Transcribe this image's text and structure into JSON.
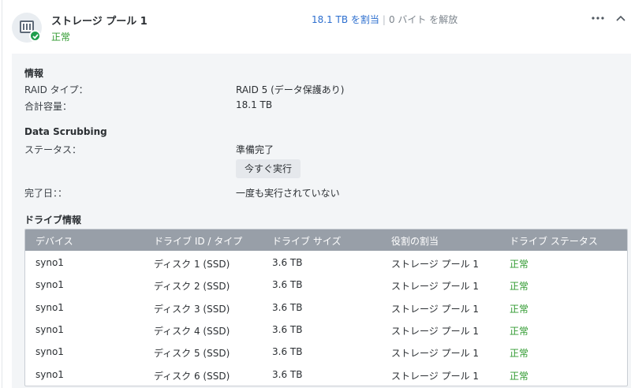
{
  "pool": {
    "title": "ストレージ プール 1",
    "status": "正常",
    "allocated": "18.1 TB を割当",
    "separator": "|",
    "freed": "0 バイト を解放",
    "more_icon": "ellipsis-icon",
    "collapse_icon": "chevron-up-icon",
    "status_color": "#2f9a2f",
    "link_color": "#2d6fcf"
  },
  "info": {
    "title": "情報",
    "raid_type_label": "RAID タイプ：",
    "raid_type_value": "RAID 5 (データ保護あり)",
    "capacity_label": "合計容量：",
    "capacity_value": "18.1 TB"
  },
  "scrubbing": {
    "title": "Data Scrubbing",
    "status_label": "ステータス：",
    "status_value": "準備完了",
    "run_now_label": "今すぐ実行",
    "completed_label": "完了日：：",
    "completed_value": "一度も実行されていない"
  },
  "drives": {
    "title": "ドライブ情報",
    "columns": [
      "デバイス",
      "ドライブ ID / タイプ",
      "ドライブ サイズ",
      "役割の割当",
      "ドライブ ステータス"
    ],
    "rows": [
      [
        "syno1",
        "ディスク 1 (SSD)",
        "3.6 TB",
        "ストレージ プール 1",
        "正常"
      ],
      [
        "syno1",
        "ディスク 2 (SSD)",
        "3.6 TB",
        "ストレージ プール 1",
        "正常"
      ],
      [
        "syno1",
        "ディスク 3 (SSD)",
        "3.6 TB",
        "ストレージ プール 1",
        "正常"
      ],
      [
        "syno1",
        "ディスク 4 (SSD)",
        "3.6 TB",
        "ストレージ プール 1",
        "正常"
      ],
      [
        "syno1",
        "ディスク 5 (SSD)",
        "3.6 TB",
        "ストレージ プール 1",
        "正常"
      ],
      [
        "syno1",
        "ディスク 6 (SSD)",
        "3.6 TB",
        "ストレージ プール 1",
        "正常"
      ]
    ]
  }
}
